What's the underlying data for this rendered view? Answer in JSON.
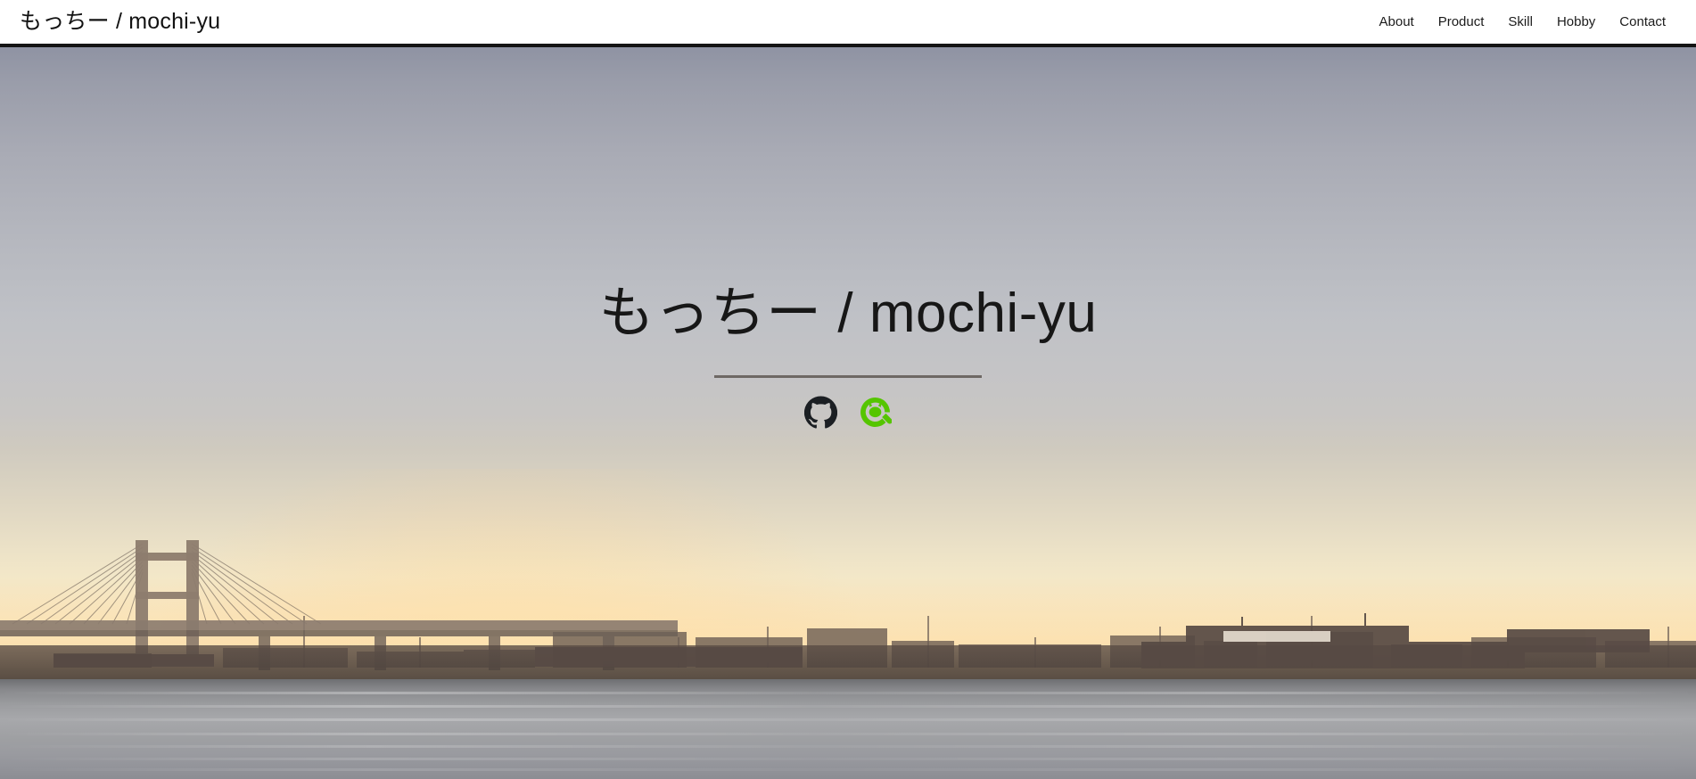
{
  "header": {
    "brand": "もっちー / mochi-yu",
    "nav": [
      {
        "label": "About"
      },
      {
        "label": "Product"
      },
      {
        "label": "Skill"
      },
      {
        "label": "Hobby"
      },
      {
        "label": "Contact"
      }
    ]
  },
  "hero": {
    "title": "もっちー / mochi-yu",
    "background_description": "Sunset photograph of Yokohama Bay Bridge and harbour with ships and water",
    "social": [
      {
        "icon": "github-icon",
        "label": "GitHub",
        "color": "#1b1f23"
      },
      {
        "icon": "qiita-icon",
        "label": "Qiita",
        "color": "#55c500"
      }
    ]
  },
  "colors": {
    "header_background": "#ffffff",
    "header_border": "#141414",
    "nav_text": "#1b1b1b",
    "brand_text": "#121212",
    "hero_title": "#171717",
    "hero_rule": "#6e6864",
    "sky_top": "#8f93a3",
    "sky_mid": "#c4c4c6",
    "sky_horizon": "#fbcb8e",
    "water": "#9a9b9e",
    "github": "#1b1f23",
    "qiita": "#55c500"
  }
}
